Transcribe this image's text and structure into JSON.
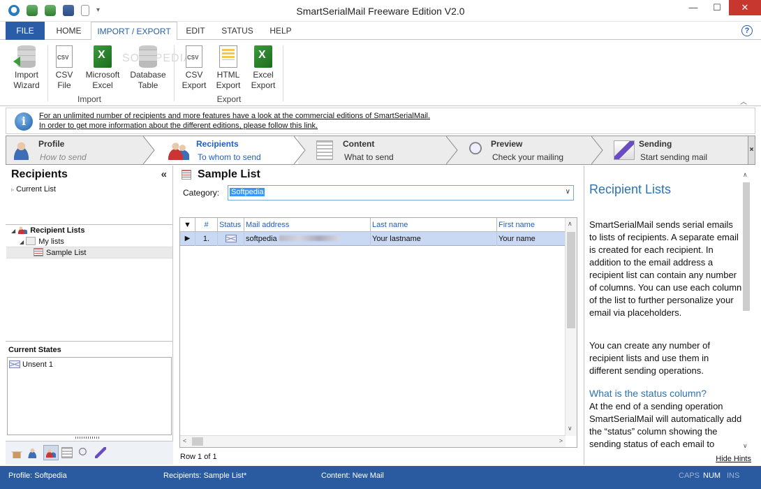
{
  "window": {
    "title": "SmartSerialMail Freeware Edition V2.0"
  },
  "ribbon_tabs": {
    "file": "FILE",
    "items": [
      "HOME",
      "IMPORT / EXPORT",
      "EDIT",
      "STATUS",
      "HELP"
    ],
    "active": "IMPORT / EXPORT"
  },
  "ribbon": {
    "import_wizard": [
      "Import",
      "Wizard"
    ],
    "csv_file": [
      "CSV",
      "File"
    ],
    "microsoft_excel": [
      "Microsoft",
      "Excel"
    ],
    "database_table": [
      "Database",
      "Table"
    ],
    "import_group": "Import",
    "csv_export": [
      "CSV",
      "Export"
    ],
    "html_export": [
      "HTML",
      "Export"
    ],
    "excel_export": [
      "Excel",
      "Export"
    ],
    "export_group": "Export",
    "csv_icon_text": "CSV",
    "watermark": "SOFTPEDIA"
  },
  "info": {
    "line1": "For an unlimited number of recipients and more features have a look at the commercial editions of SmartSerialMail.",
    "line2": "In order to get more information about the different editions, please follow this link."
  },
  "steps": [
    {
      "title": "Profile",
      "subtitle": "How to send",
      "state": "done"
    },
    {
      "title": "Recipients",
      "subtitle": "To whom to send",
      "state": "active"
    },
    {
      "title": "Content",
      "subtitle": "What to send",
      "state": ""
    },
    {
      "title": "Preview",
      "subtitle": "Check your mailing",
      "state": ""
    },
    {
      "title": "Sending",
      "subtitle": "Start sending mail",
      "state": ""
    }
  ],
  "left_panel": {
    "title": "Recipients",
    "collapse_glyph": "«",
    "current_list": "Current List",
    "recipient_lists": "Recipient Lists",
    "my_lists": "My lists",
    "sample_list": "Sample List",
    "current_states": "Current States",
    "unsent": "Unsent 1"
  },
  "center": {
    "title": "Sample List",
    "category_label": "Category:",
    "category_value": "Softpedia",
    "columns": [
      "#",
      "Status",
      "Mail address",
      "Last name",
      "First name"
    ],
    "rows": [
      {
        "num": "1.",
        "mail": "softpedia",
        "last": "Your lastname",
        "first": "Your name"
      }
    ],
    "row_count": "Row 1 of 1"
  },
  "hints": {
    "title": "Recipient Lists",
    "p1": "SmartSerialMail sends serial emails to lists of recipients. A separate email is created for each recipient. In addition to the email address a recipient list can contain any number of columns. You can use each column of the list to further personalize your email via placeholders.",
    "p2": "You can create any number of recipient lists and use them in different sending operations.",
    "sub": "What is the status column?",
    "p3": "At the end of a sending operation SmartSerialMail will automatically add the “status” column showing the sending status of each email to",
    "hide": "Hide Hints"
  },
  "statusbar": {
    "profile": "Profile: Softpedia",
    "recipients": "Recipients: Sample List*",
    "content": "Content: New Mail",
    "caps": "CAPS",
    "num": "NUM",
    "ins": "INS"
  },
  "colors": {
    "accent": "#2a5da8",
    "status_bar": "#2a5aa0",
    "hint_blue": "#2a73b8",
    "selected_row": "#c9d8f3"
  }
}
